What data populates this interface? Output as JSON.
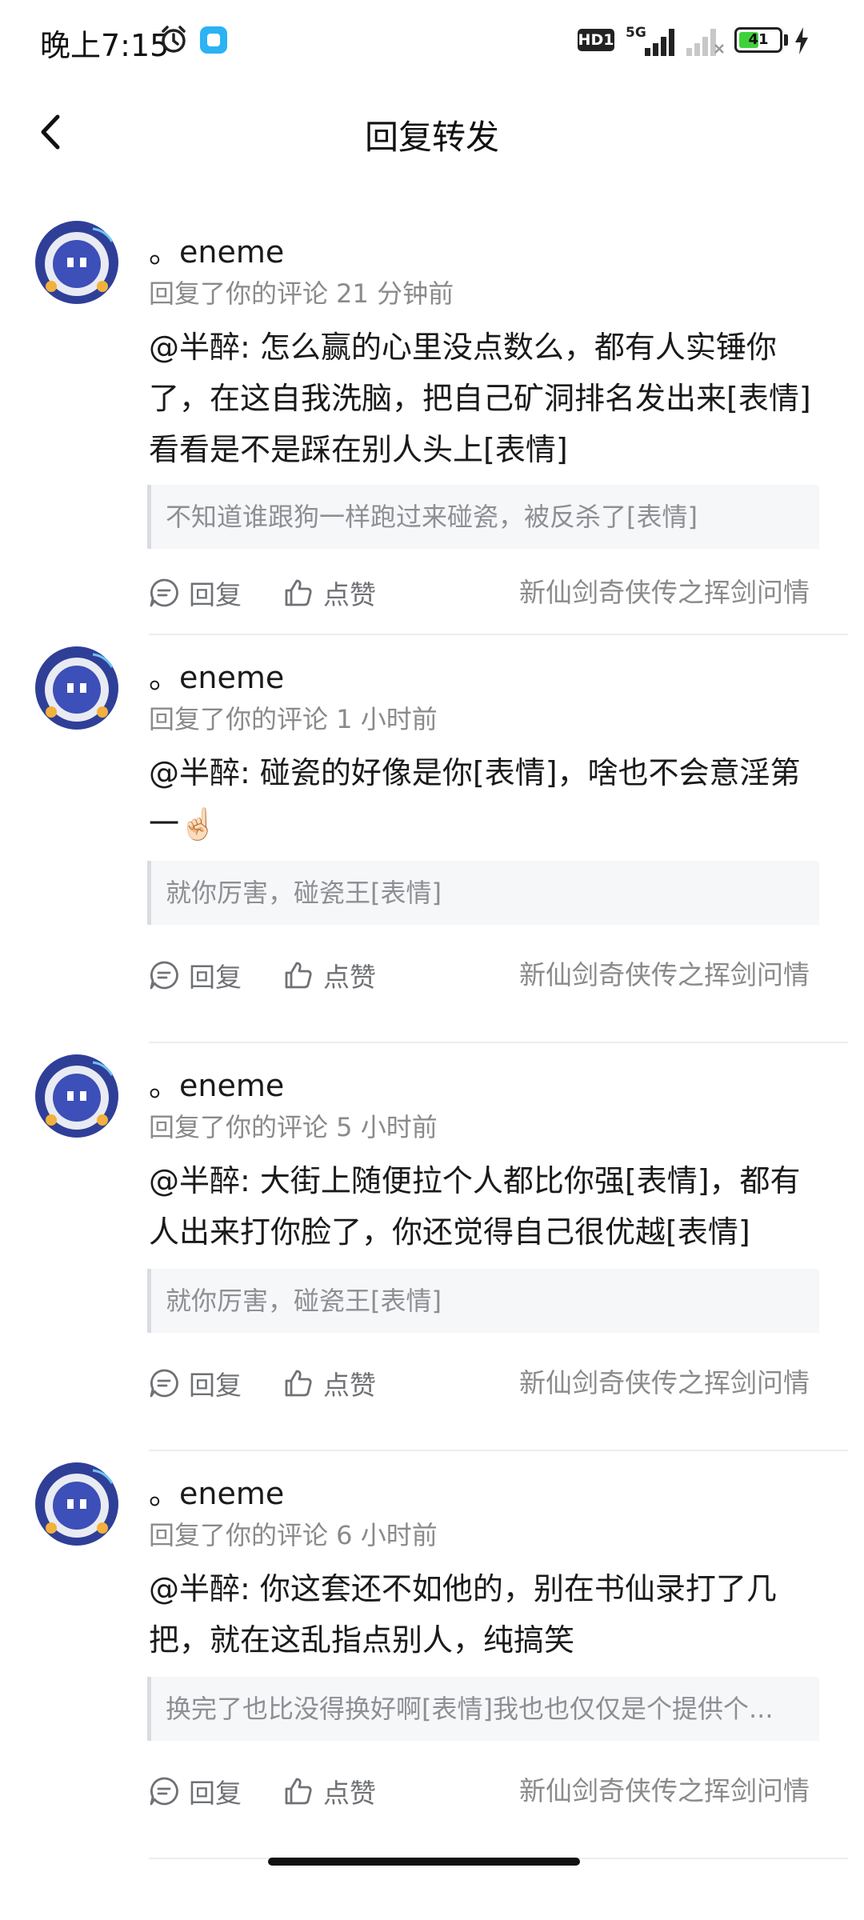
{
  "status_bar": {
    "time": "晚上7:15",
    "hd_badge": "HD1",
    "network": "5G",
    "battery": "41",
    "icons": [
      "alarm-icon",
      "app-notification-icon",
      "signal-icon",
      "signal-empty-icon",
      "battery-icon",
      "charging-icon"
    ]
  },
  "header": {
    "title": "回复转发",
    "back_icon": "chevron-left-icon"
  },
  "actions": {
    "reply_label": "回复",
    "like_label": "点赞"
  },
  "items": [
    {
      "user": "。eneme",
      "meta": "回复了你的评论 21 分钟前",
      "body": "@半醉: 怎么赢的心里没点数么，都有人实锤你了，在这自我洗脑，把自己矿洞排名发出来[表情]看看是不是踩在别人头上[表情]",
      "quote": "不知道谁跟狗一样跑过来碰瓷，被反杀了[表情]",
      "game": "新仙剑奇侠传之挥剑问情"
    },
    {
      "user": "。eneme",
      "meta": "回复了你的评论 1 小时前",
      "body": "@半醉: 碰瓷的好像是你[表情]，啥也不会意淫第一☝🏻",
      "quote": "就你厉害，碰瓷王[表情]",
      "game": "新仙剑奇侠传之挥剑问情"
    },
    {
      "user": "。eneme",
      "meta": "回复了你的评论 5 小时前",
      "body": "@半醉: 大街上随便拉个人都比你强[表情]，都有人出来打你脸了，你还觉得自己很优越[表情]",
      "quote": "就你厉害，碰瓷王[表情]",
      "game": "新仙剑奇侠传之挥剑问情"
    },
    {
      "user": "。eneme",
      "meta": "回复了你的评论 6 小时前",
      "body": "@半醉: 你这套还不如他的，别在书仙录打了几把，就在这乱指点别人，纯搞笑",
      "quote": "换完了也比没得换好啊[表情]我也也仅仅是个提供个...",
      "game": "新仙剑奇侠传之挥剑问情"
    }
  ],
  "colors": {
    "avatar_ring": "#2f3f98",
    "avatar_face": "#3d4fb8",
    "avatar_accent": "#f2b13a",
    "muted_text": "#8a8a8a"
  }
}
